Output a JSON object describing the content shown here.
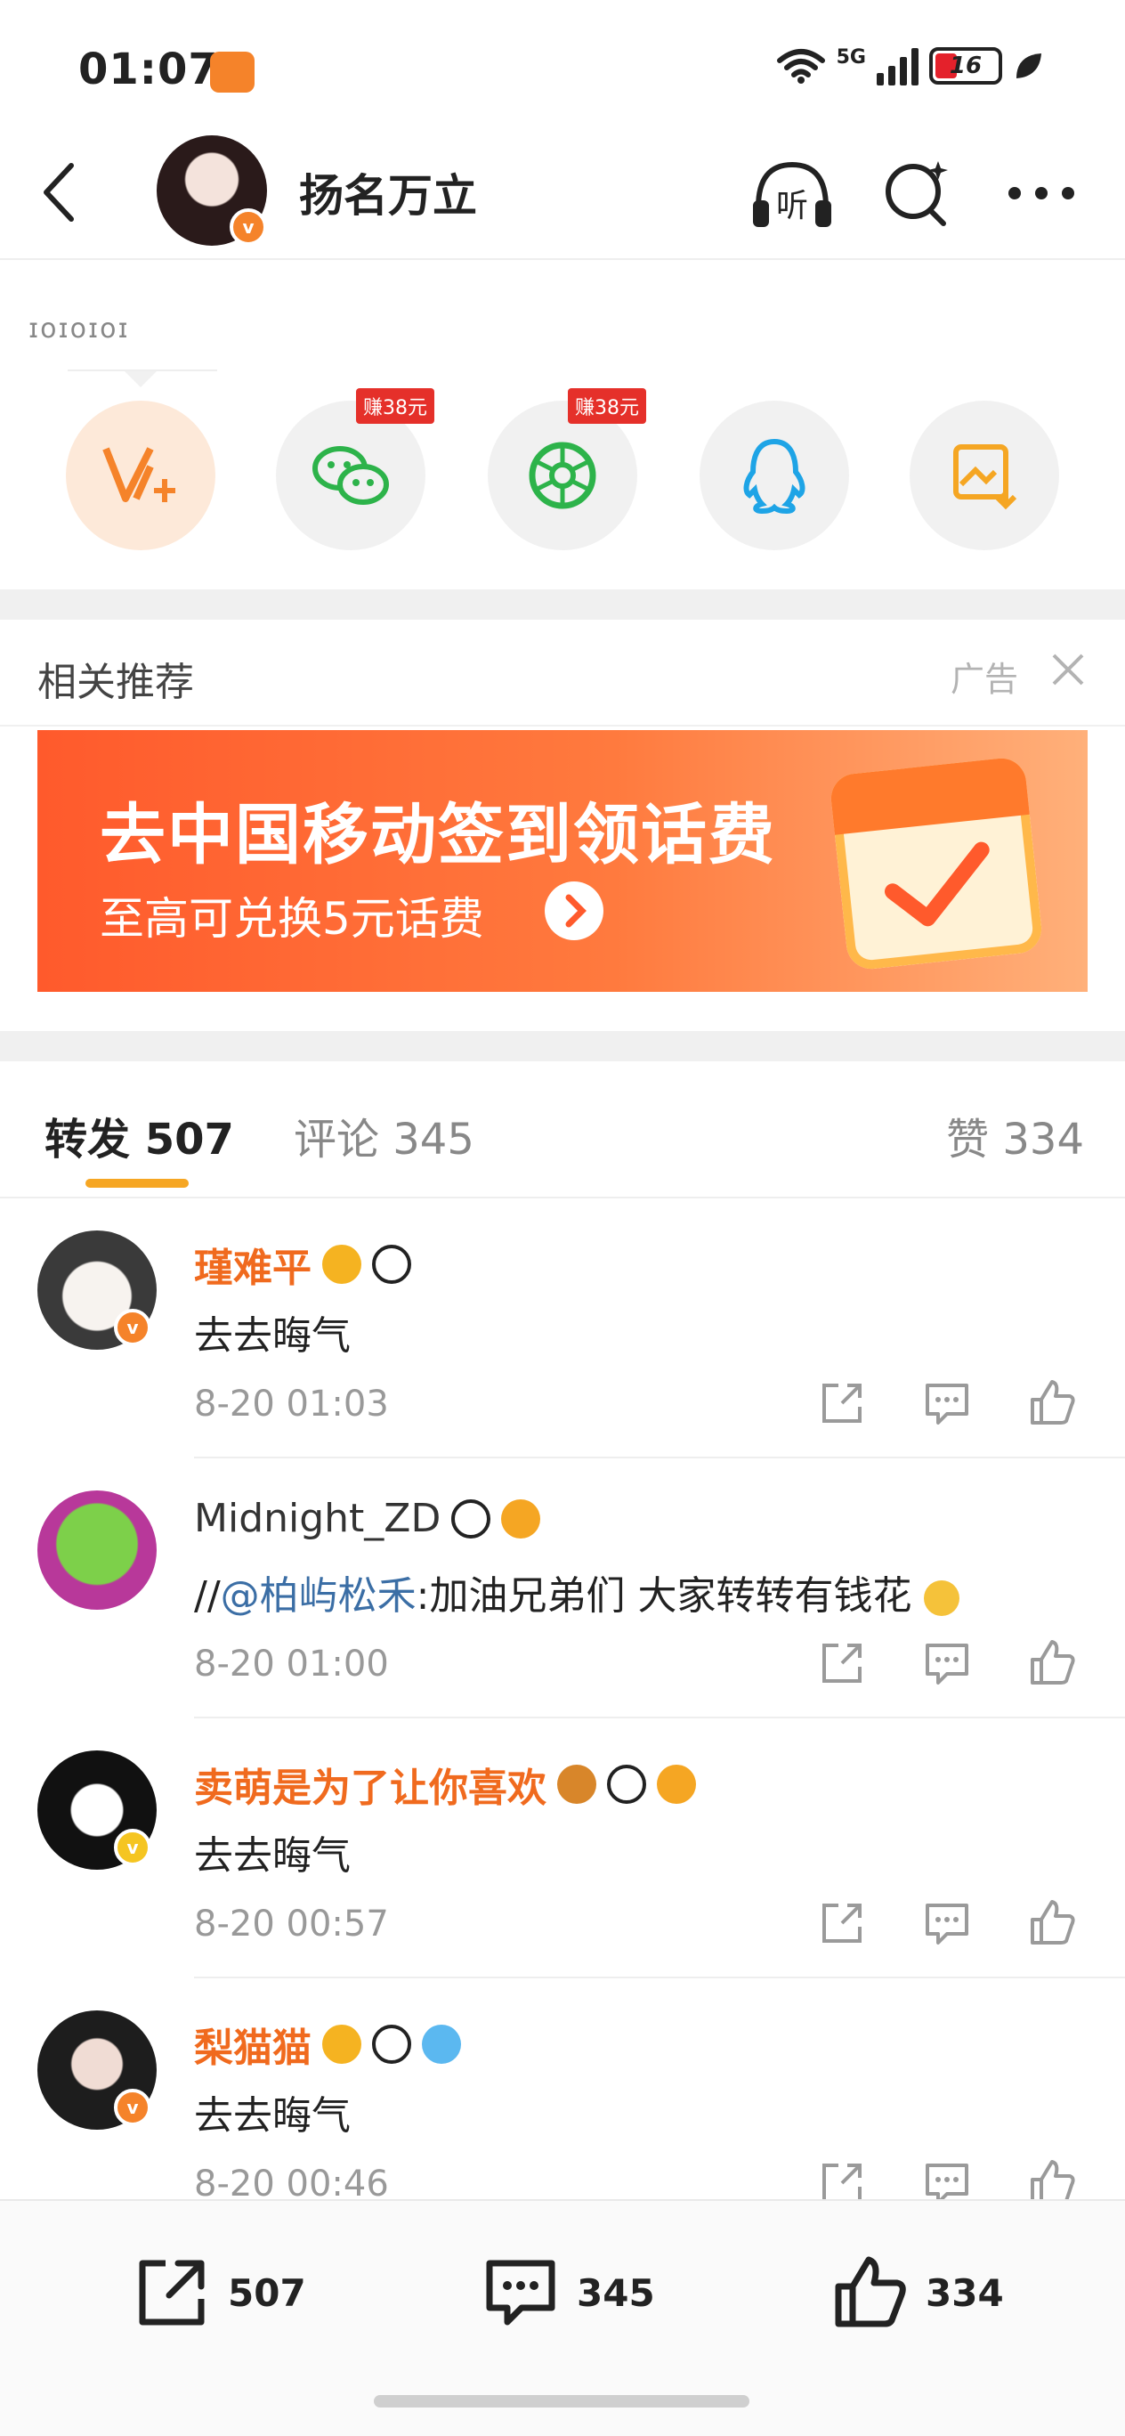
{
  "status_bar": {
    "time": "01:07",
    "network": "5G",
    "battery": "16"
  },
  "header": {
    "name": "扬名万立",
    "verified_mark": "v"
  },
  "share_strip": {
    "tiny_text": "ɪoɪoɪoɪ",
    "items": [
      {
        "name": "v-plus",
        "promo": ""
      },
      {
        "name": "wechat",
        "promo": "赚38元"
      },
      {
        "name": "moments",
        "promo": "赚38元"
      },
      {
        "name": "qq",
        "promo": ""
      },
      {
        "name": "save-image",
        "promo": ""
      }
    ]
  },
  "recommend": {
    "title": "相关推荐",
    "ad_label": "广告"
  },
  "ad": {
    "headline": "去中国移动签到领话费",
    "subline": "至高可兑换5元话费"
  },
  "tabs": {
    "repost": "转发 507",
    "comment": "评论 345",
    "like": "赞 334"
  },
  "comments": [
    {
      "name": "瑾难平",
      "text": "去去晦气",
      "time": "8-20 01:03",
      "name_color": "orange"
    },
    {
      "name": "Midnight_ZD",
      "text_prefix": "//",
      "mention": "@柏屿松禾",
      "text": ":加油兄弟们 大家转转有钱花",
      "time": "8-20 01:00",
      "name_color": "plain"
    },
    {
      "name": "卖萌是为了让你喜欢",
      "text": "去去晦气",
      "time": "8-20 00:57",
      "name_color": "orange"
    },
    {
      "name": "梨猫猫",
      "text": "去去晦气",
      "time": "8-20 00:46",
      "name_color": "orange"
    }
  ],
  "bottom_bar": {
    "repost_count": "507",
    "comment_count": "345",
    "like_count": "334"
  },
  "colors": {
    "accent_orange": "#f06a1e",
    "tab_underline": "#f6a623",
    "mention_blue": "#3b6ea5",
    "promo_red": "#e5302a"
  }
}
